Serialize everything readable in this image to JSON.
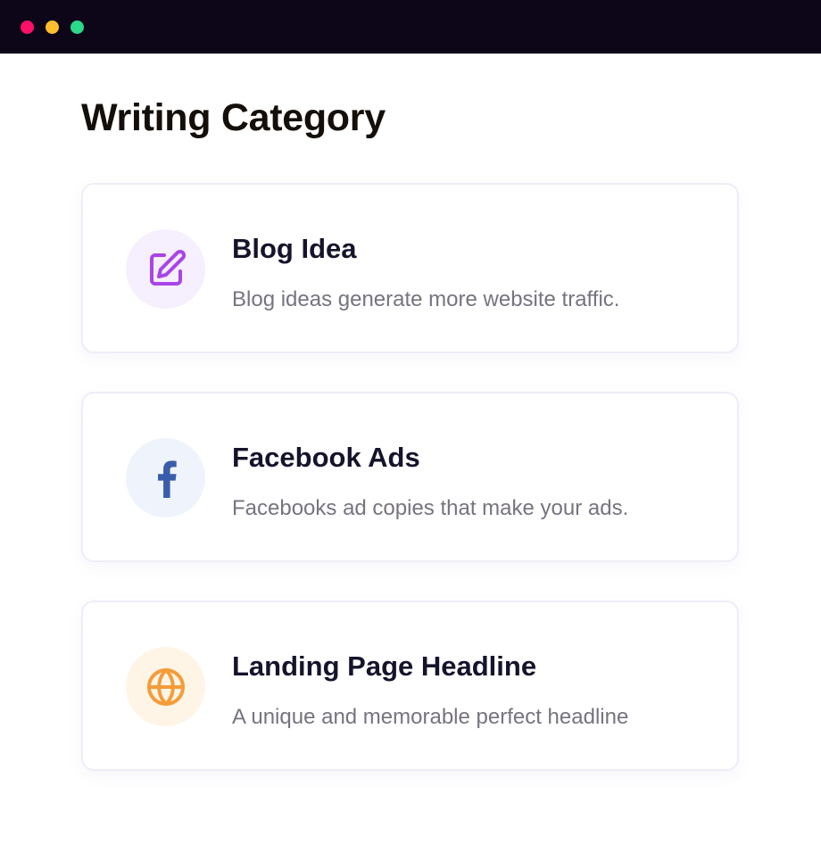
{
  "window": {
    "controls": [
      {
        "name": "close",
        "color": "#ff0f68"
      },
      {
        "name": "minimize",
        "color": "#ffbf2d"
      },
      {
        "name": "maximize",
        "color": "#2bd98a"
      }
    ]
  },
  "page": {
    "title": "Writing Category"
  },
  "categories": [
    {
      "title": "Blog Idea",
      "description": "Blog ideas generate more website traffic.",
      "icon": "edit-icon",
      "icon_color": "#a944e8",
      "icon_bg": "#f6effd"
    },
    {
      "title": "Facebook Ads",
      "description": "Facebooks ad copies that make your ads.",
      "icon": "facebook-icon",
      "icon_color": "#3a5dab",
      "icon_bg": "#eff3fb"
    },
    {
      "title": "Landing Page Headline",
      "description": "A unique and memorable perfect headline",
      "icon": "globe-icon",
      "icon_color": "#f59c3a",
      "icon_bg": "#fff5e6"
    }
  ]
}
